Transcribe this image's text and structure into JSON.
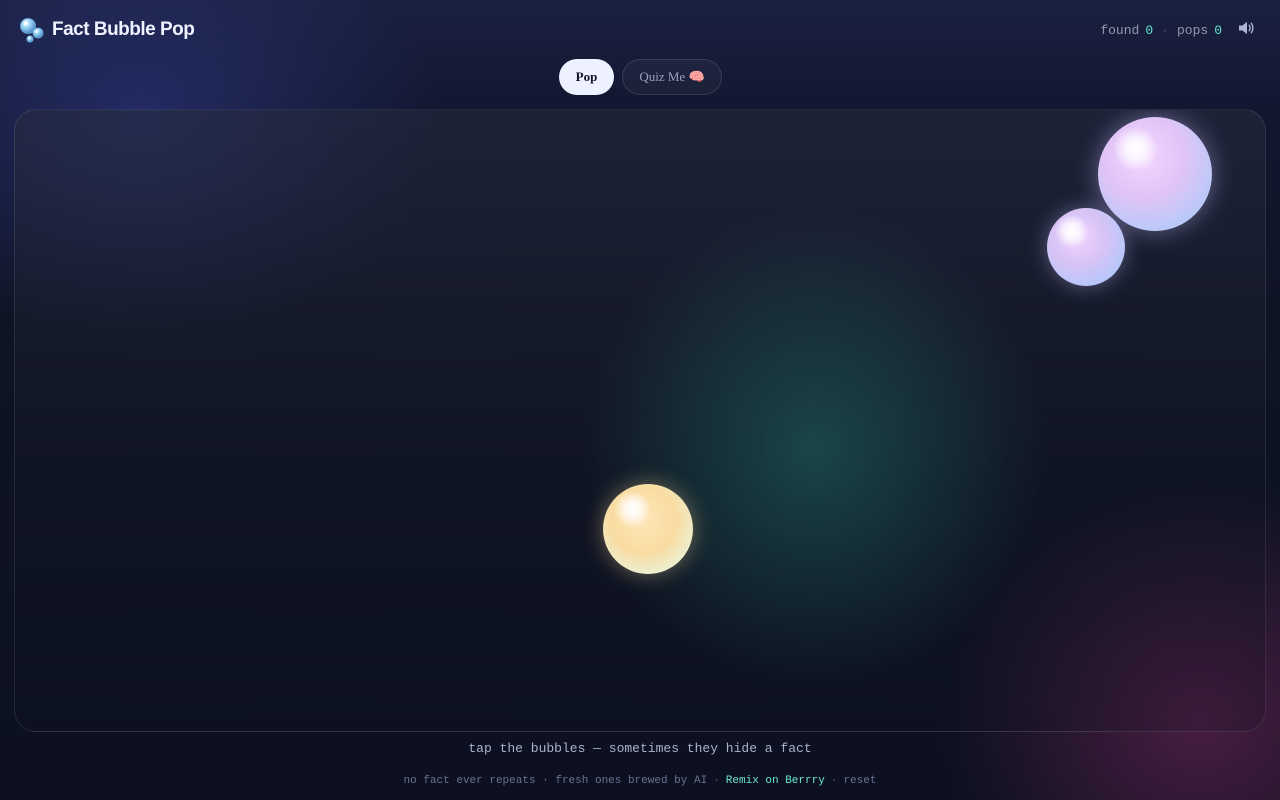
{
  "app": {
    "title": "Fact Bubble Pop",
    "logo_icon": "bubbles-icon"
  },
  "stats": {
    "found_label": "found",
    "found_value": "0",
    "separator": "·",
    "pops_label": "pops",
    "pops_value": "0",
    "sound_icon": "speaker-icon"
  },
  "tabs": [
    {
      "label": "Pop",
      "active": true
    },
    {
      "label": "Quiz Me 🧠",
      "active": false
    }
  ],
  "play_area": {
    "bubbles": [
      {
        "color": "lavender-blue"
      },
      {
        "color": "lavender-blue"
      },
      {
        "color": "gold-mint"
      }
    ]
  },
  "hint": "tap the bubbles — sometimes they hide a fact",
  "footer": {
    "text": "no fact ever repeats · fresh ones brewed by AI",
    "separator": "·",
    "remix_label": "Remix on Berrry",
    "reset_label": "reset"
  },
  "colors": {
    "accent_teal": "#5fe0cf",
    "tab_active_bg": "#eef1ff",
    "background": "#0e1220"
  }
}
